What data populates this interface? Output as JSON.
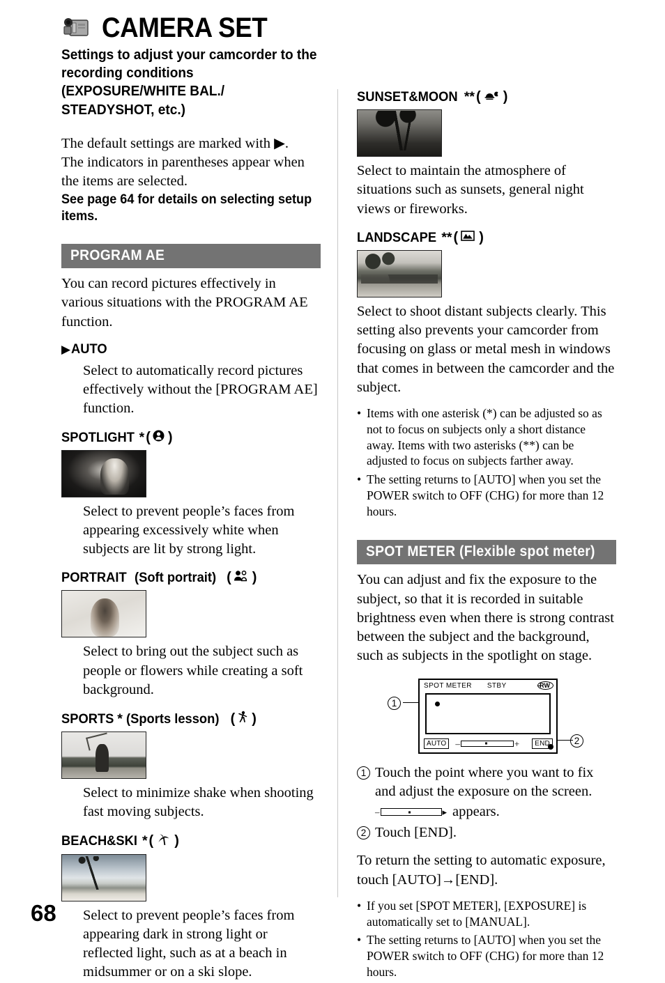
{
  "header": {
    "icon": "camcorder-icon",
    "title": "CAMERA SET",
    "subtitle": "Settings to adjust your camcorder to the recording conditions (EXPOSURE/WHITE BAL./ STEADYSHOT, etc.)"
  },
  "intro": {
    "line1": "The default settings are marked with ▶.",
    "line2": "The indicators in parentheses appear when the items are selected.",
    "bold": "See page 64 for details on selecting setup items."
  },
  "program_ae": {
    "section_title": "PROGRAM AE",
    "description": "You can record pictures effectively in various situations with the PROGRAM AE function.",
    "modes": [
      {
        "marker": "▶",
        "name": "AUTO",
        "asterisk": "",
        "sub": "",
        "icon": "",
        "has_icon": false,
        "has_photo": false,
        "photo": "",
        "body": "Select to automatically record pictures effectively without the [PROGRAM AE] function."
      },
      {
        "marker": "",
        "name": "SPOTLIGHT",
        "asterisk": "*",
        "sub": "",
        "icon": "spotlight-person-icon",
        "has_icon": true,
        "has_photo": true,
        "photo": "woman-in-spotlight-photo",
        "body": "Select to prevent people’s faces from appearing excessively white when subjects are lit by strong light."
      },
      {
        "marker": "",
        "name": "PORTRAIT",
        "asterisk": "",
        "sub": "(Soft portrait)",
        "icon": "portrait-person-icon",
        "has_icon": true,
        "has_photo": true,
        "photo": "portrait-face-photo",
        "body": "Select to bring out the subject such as people or flowers while creating a soft background."
      },
      {
        "marker": "",
        "name": "SPORTS",
        "asterisk": "*",
        "sub": "(Sports lesson)",
        "icon": "running-person-icon",
        "has_icon": true,
        "has_photo": true,
        "photo": "golfer-photo",
        "body": "Select to minimize shake when shooting fast moving subjects."
      },
      {
        "marker": "",
        "name": "BEACH&SKI",
        "asterisk": "*",
        "sub": "",
        "icon": "palm-tree-icon",
        "has_icon": true,
        "has_photo": true,
        "photo": "beach-palms-photo",
        "body": "Select to prevent people’s faces from appearing dark in strong light or reflected light, such as at a beach in midsummer or on a ski slope."
      },
      {
        "marker": "",
        "name": "SUNSET&MOON",
        "asterisk": "**",
        "sub": "",
        "icon": "sunset-moon-icon",
        "has_icon": true,
        "has_photo": true,
        "photo": "sunset-palms-photo",
        "body": "Select to maintain the atmosphere of situations such as sunsets, general night views or fireworks."
      },
      {
        "marker": "",
        "name": "LANDSCAPE",
        "asterisk": "**",
        "sub": "",
        "icon": "mountain-landscape-icon",
        "has_icon": true,
        "has_photo": true,
        "photo": "bridge-landscape-photo",
        "body": "Select to shoot distant subjects clearly. This setting also prevents your camcorder from focusing on glass or metal mesh in windows that comes in between the camcorder and the subject."
      }
    ],
    "notes": [
      "Items with one asterisk (*) can be adjusted so as not to focus on subjects only a short distance away. Items with two asterisks (**) can be adjusted to focus on subjects farther away.",
      "The setting returns to [AUTO] when you set the POWER switch to OFF (CHG) for more than 12 hours."
    ]
  },
  "spot_meter": {
    "section_title": "SPOT METER (Flexible spot meter)",
    "description": "You can adjust and fix the exposure to the subject, so that it is recorded in suitable brightness even when there is strong contrast between the subject and the background, such as subjects in the spotlight on stage.",
    "lcd": {
      "label_mode": "SPOT METER",
      "label_status": "STBY",
      "label_tape": "RW",
      "button_auto": "AUTO",
      "button_end": "END",
      "callout_1": "1",
      "callout_2": "2"
    },
    "steps": [
      {
        "num": "1",
        "text": "Touch the point where you want to fix and adjust the exposure on the screen."
      },
      {
        "num": "2",
        "text": "Touch [END]."
      }
    ],
    "appears_text": "appears.",
    "return_text": "To return the setting to automatic exposure, touch [AUTO]→[END].",
    "notes": [
      "If you set [SPOT METER], [EXPOSURE] is automatically set to [MANUAL].",
      "The setting returns to [AUTO] when you set the POWER switch to OFF (CHG) for more than 12 hours."
    ]
  },
  "page_number": "68",
  "colors": {
    "section_bar": "#737373",
    "text": "#000000",
    "divider": "#c9c9c9"
  }
}
